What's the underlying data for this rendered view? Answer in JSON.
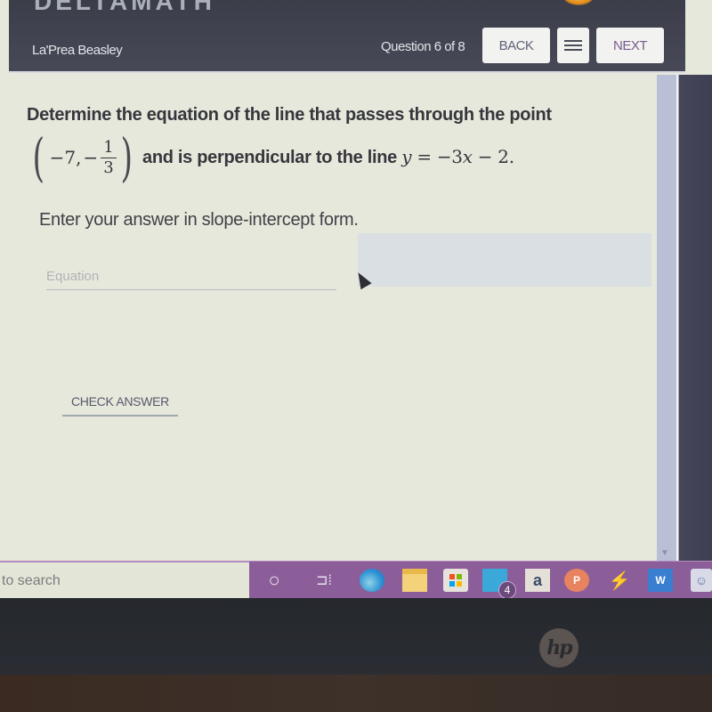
{
  "header": {
    "brand": "DELTAMATH",
    "student_name": "La'Prea Beasley",
    "question_counter": "Question 6 of 8",
    "back_label": "BACK",
    "menu_icon": "hamburger-menu-icon",
    "next_label": "NEXT"
  },
  "question": {
    "line1": "Determine the equation of the line that passes through the point",
    "point": {
      "x": "−7,",
      "y_sign": "−",
      "y_numerator": "1",
      "y_denominator": "3",
      "open_paren": "(",
      "close_paren": ")"
    },
    "line2_text": "and is perpendicular to the line",
    "line2_math_var": "y",
    "line2_math_rest": " = −3",
    "line2_math_x": "x",
    "line2_math_tail": " − 2.",
    "instruction": "Enter your answer in slope-intercept form."
  },
  "answer": {
    "placeholder": "Equation",
    "value": "",
    "check_label": "CHECK ANSWER"
  },
  "taskbar": {
    "search_text": "to search",
    "icons": [
      "cortana-icon",
      "task-view-icon",
      "edge-icon",
      "file-explorer-icon",
      "microsoft-store-icon",
      "mail-icon",
      "amazon-icon",
      "powerpoint-icon",
      "bolt-app-icon",
      "word-icon",
      "anime-app-icon"
    ],
    "cortana_glyph": "○",
    "taskview_glyph": "⊐⁞",
    "mail_badge": "4",
    "amazon_glyph": "a",
    "ppt_glyph": "P",
    "bolt_glyph": "⚡",
    "word_glyph": "W",
    "anime_glyph": "☺"
  },
  "device": {
    "logo": "hp"
  },
  "colors": {
    "header_bg": "#434552",
    "taskbar_bg": "#8c5e99",
    "screen_bg": "#e7e8dc",
    "preview_box": "#d9dfe3",
    "next_text": "#7a5a8e"
  }
}
